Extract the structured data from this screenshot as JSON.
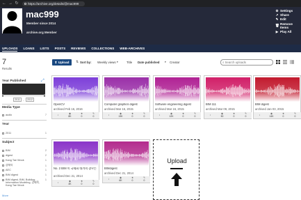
{
  "browser": {
    "url": "https://archive.org/details/@mac999"
  },
  "profile": {
    "username": "mac999",
    "member_since": "Member since 2014",
    "role": "archive.org Member"
  },
  "actions": [
    {
      "label": "Settings",
      "icon": "gear-icon",
      "glyph": "⚙"
    },
    {
      "label": "Share",
      "icon": "share-icon",
      "glyph": "↗"
    },
    {
      "label": "Edit",
      "icon": "pencil-icon",
      "glyph": "✎"
    },
    {
      "label": "Remove Items",
      "icon": "trash-icon",
      "glyph": "🗑"
    },
    {
      "label": "Play All",
      "icon": "play-icon",
      "glyph": "▶"
    }
  ],
  "tabs": [
    "UPLOADS",
    "LOANS",
    "LISTS",
    "POSTS",
    "REVIEWS",
    "COLLECTIONS",
    "WEB-ARCHIVES"
  ],
  "sidebar": {
    "result_count": "7",
    "result_label": "Results",
    "year_published": {
      "title": "Year Published",
      "from": "2011",
      "to": "2012"
    },
    "media_type": {
      "title": "Media Type",
      "items": [
        {
          "label": "audio",
          "count": "7"
        }
      ]
    },
    "year": {
      "title": "Year",
      "items": [
        {
          "label": "2011",
          "count": "1"
        }
      ]
    },
    "subject": {
      "title": "Subject",
      "items": [
        {
          "label": "BIM",
          "count": "2"
        },
        {
          "label": "digest",
          "count": "2"
        },
        {
          "label": "Kang Tae Wook",
          "count": "1"
        },
        {
          "label": "강태욱",
          "count": "1"
        },
        {
          "label": "AEC",
          "count": "1"
        },
        {
          "label": "BIM digest",
          "count": "1"
        },
        {
          "label": "BIM digest, BIM, Building Information Modeling, 강태욱, Kang Tae Wook",
          "count": "1"
        }
      ],
      "more": "More"
    }
  },
  "toolbar": {
    "upload_label": "Upload",
    "sort_by": "Sort by:",
    "weekly_views": "Weekly views",
    "title": "Title",
    "date_published": "Date published",
    "creator": "Creator",
    "search_placeholder": "Search uploads"
  },
  "items": [
    {
      "title": "OpenCV",
      "archived": "archived Feb 16, 2016",
      "views": "8K",
      "favs": "0",
      "reviews": "0",
      "color": "#7d3fd9"
    },
    {
      "title": "Computer graphics digest",
      "archived": "archived Mar 16, 2015",
      "views": "13K",
      "favs": "0",
      "reviews": "0",
      "color": "#9a2fa8"
    },
    {
      "title": "Software engineering digest",
      "archived": "archived Mar 16, 2015",
      "views": "12K",
      "favs": "0",
      "reviews": "0",
      "color": "#b02294"
    },
    {
      "title": "BIM 111",
      "archived": "archived Mar 09, 2015",
      "views": "50",
      "favs": "0",
      "reviews": "0",
      "color": "#d11f68"
    },
    {
      "title": "BIM digest",
      "archived": "archived Jan 03, 2015",
      "views": "14K",
      "favs": "0",
      "reviews": "0",
      "color": "#c21a2e"
    },
    {
      "title": "No. 2 BIM 이 국제화 대가의 경우는",
      "archived": "archived Dec 21, 2014",
      "views": "4K",
      "favs": "0",
      "reviews": "0",
      "color": "#8b35c9"
    },
    {
      "title": "BIMdigest",
      "archived": "archived Dec 21, 2014",
      "views": "6K",
      "favs": "0",
      "reviews": "0",
      "color": "#b32c8e"
    }
  ],
  "upload_tile": {
    "title": "Upload"
  }
}
